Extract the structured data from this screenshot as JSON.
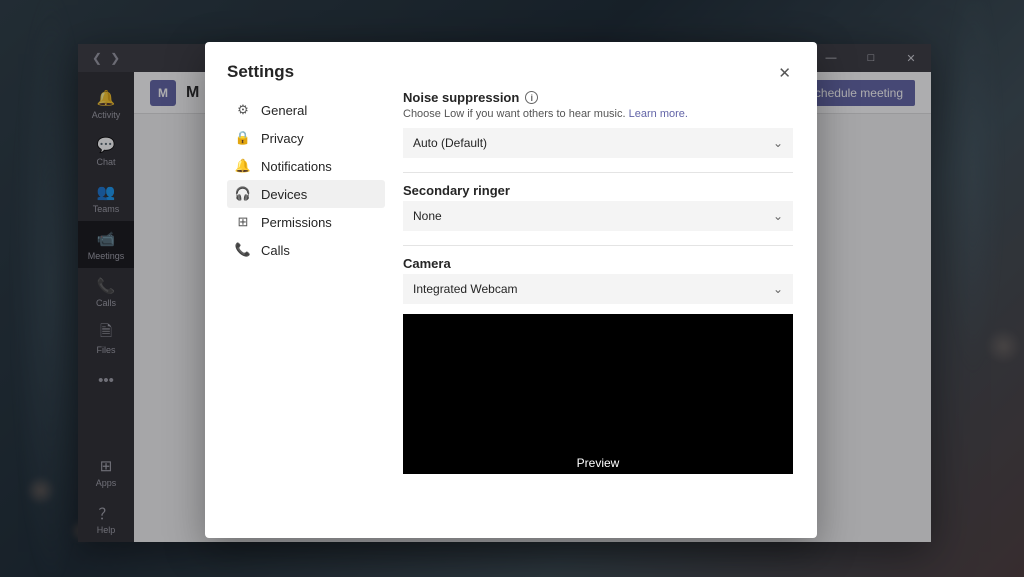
{
  "window": {
    "minimize": "—",
    "maximize": "□",
    "close": "✕"
  },
  "rail": {
    "activity": "Activity",
    "chat": "Chat",
    "teams": "Teams",
    "meetings": "Meetings",
    "calls": "Calls",
    "files": "Files",
    "more": "•••",
    "apps": "Apps",
    "help": "Help"
  },
  "header": {
    "icon_text": "M",
    "title": "M",
    "schedule_btn": "Schedule meeting"
  },
  "settings": {
    "title": "Settings",
    "close": "✕",
    "nav": {
      "general": "General",
      "privacy": "Privacy",
      "notifications": "Notifications",
      "devices": "Devices",
      "permissions": "Permissions",
      "calls": "Calls"
    },
    "noise": {
      "title": "Noise suppression",
      "desc": "Choose Low if you want others to hear music.",
      "learn": "Learn more.",
      "value": "Auto (Default)"
    },
    "ringer": {
      "title": "Secondary ringer",
      "value": "None"
    },
    "camera": {
      "title": "Camera",
      "value": "Integrated Webcam",
      "preview_label": "Preview"
    }
  }
}
